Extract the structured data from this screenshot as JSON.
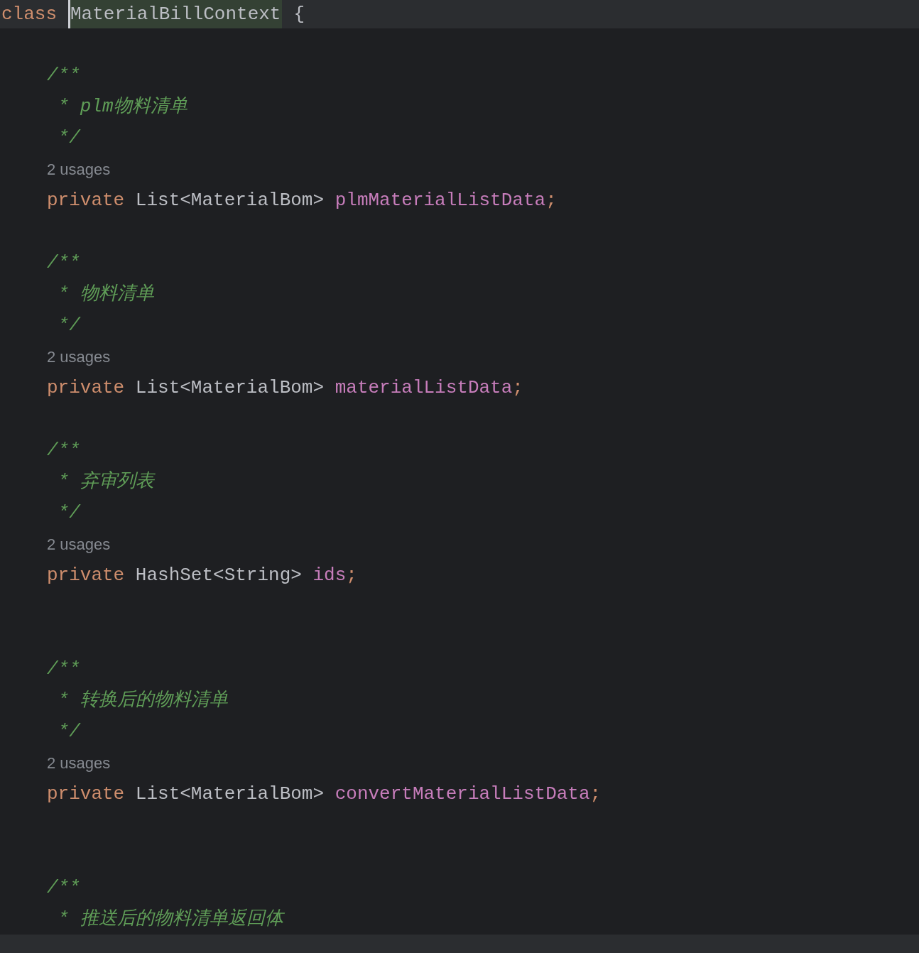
{
  "header": {
    "keyword": "class",
    "name": "MaterialBillContext",
    "brace": "{"
  },
  "lines": [
    {
      "kind": "blank"
    },
    {
      "kind": "comment",
      "text": "/**"
    },
    {
      "kind": "comment",
      "text": " * plm物料清单"
    },
    {
      "kind": "comment",
      "text": " */"
    },
    {
      "kind": "usages",
      "text": "2 usages"
    },
    {
      "kind": "field",
      "keyword": "private",
      "type": "List<MaterialBom>",
      "name": "plmMaterialListData",
      "end": ";"
    },
    {
      "kind": "blank"
    },
    {
      "kind": "comment",
      "text": "/**"
    },
    {
      "kind": "comment",
      "text": " * 物料清单"
    },
    {
      "kind": "comment",
      "text": " */"
    },
    {
      "kind": "usages",
      "text": "2 usages"
    },
    {
      "kind": "field",
      "keyword": "private",
      "type": "List<MaterialBom>",
      "name": "materialListData",
      "end": ";"
    },
    {
      "kind": "blank"
    },
    {
      "kind": "comment",
      "text": "/**"
    },
    {
      "kind": "comment",
      "text": " * 弃审列表"
    },
    {
      "kind": "comment",
      "text": " */"
    },
    {
      "kind": "usages",
      "text": "2 usages"
    },
    {
      "kind": "field",
      "keyword": "private",
      "type": "HashSet<String>",
      "name": "ids",
      "end": ";"
    },
    {
      "kind": "blank"
    },
    {
      "kind": "blank"
    },
    {
      "kind": "comment",
      "text": "/**"
    },
    {
      "kind": "comment",
      "text": " * 转换后的物料清单"
    },
    {
      "kind": "comment",
      "text": " */"
    },
    {
      "kind": "usages",
      "text": "2 usages"
    },
    {
      "kind": "field",
      "keyword": "private",
      "type": "List<MaterialBom>",
      "name": "convertMaterialListData",
      "end": ";"
    },
    {
      "kind": "blank"
    },
    {
      "kind": "blank"
    },
    {
      "kind": "comment",
      "text": "/**"
    },
    {
      "kind": "comment",
      "text": " * 推送后的物料清单返回体"
    }
  ]
}
